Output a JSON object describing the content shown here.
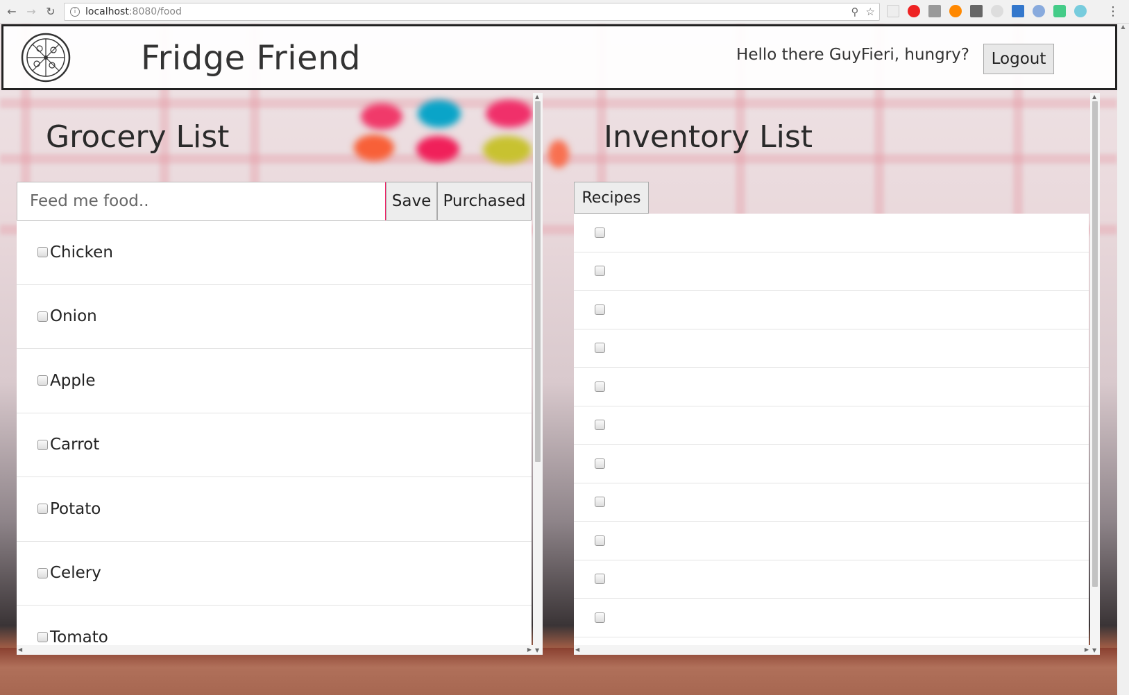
{
  "browser": {
    "url_host": "localhost",
    "url_path": ":8080/food"
  },
  "header": {
    "title": "Fridge Friend",
    "greeting": "Hello there GuyFieri, hungry?",
    "logout_label": "Logout"
  },
  "grocery": {
    "title": "Grocery List",
    "input_placeholder": "Feed me food..",
    "save_label": "Save",
    "purchased_label": "Purchased",
    "items": [
      {
        "label": "Chicken",
        "checked": false
      },
      {
        "label": "Onion",
        "checked": false
      },
      {
        "label": "Apple",
        "checked": false
      },
      {
        "label": "Carrot",
        "checked": false
      },
      {
        "label": "Potato",
        "checked": false
      },
      {
        "label": "Celery",
        "checked": false
      },
      {
        "label": "Tomato",
        "checked": false
      }
    ]
  },
  "inventory": {
    "title": "Inventory List",
    "recipes_label": "Recipes",
    "items": [
      {
        "label": "",
        "checked": false
      },
      {
        "label": "",
        "checked": false
      },
      {
        "label": "",
        "checked": false
      },
      {
        "label": "",
        "checked": false
      },
      {
        "label": "",
        "checked": false
      },
      {
        "label": "",
        "checked": false
      },
      {
        "label": "",
        "checked": false
      },
      {
        "label": "",
        "checked": false
      },
      {
        "label": "",
        "checked": false
      },
      {
        "label": "",
        "checked": false
      },
      {
        "label": "",
        "checked": false
      },
      {
        "label": "",
        "checked": false
      }
    ]
  },
  "icons": [
    "back-arrow-icon",
    "forward-arrow-icon",
    "reload-icon",
    "info-icon",
    "zoom-icon",
    "bookmark-star-icon",
    "menu-kebab-icon",
    "pizza-logo-icon"
  ]
}
